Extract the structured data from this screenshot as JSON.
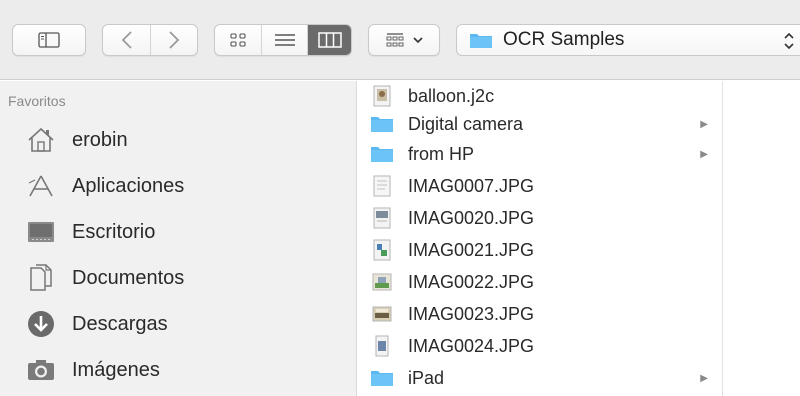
{
  "path": {
    "folder_name": "OCR Samples"
  },
  "sidebar": {
    "heading": "Favoritos",
    "items": [
      {
        "label": "erobin",
        "icon": "home-icon"
      },
      {
        "label": "Aplicaciones",
        "icon": "applications-icon"
      },
      {
        "label": "Escritorio",
        "icon": "desktop-icon"
      },
      {
        "label": "Documentos",
        "icon": "documents-icon"
      },
      {
        "label": "Descargas",
        "icon": "downloads-icon"
      },
      {
        "label": "Imágenes",
        "icon": "camera-icon"
      }
    ]
  },
  "files": [
    {
      "name": "balloon.j2c",
      "kind": "image"
    },
    {
      "name": "Digital camera",
      "kind": "folder"
    },
    {
      "name": "from HP",
      "kind": "folder"
    },
    {
      "name": "IMAG0007.JPG",
      "kind": "image"
    },
    {
      "name": "IMAG0020.JPG",
      "kind": "image"
    },
    {
      "name": "IMAG0021.JPG",
      "kind": "image"
    },
    {
      "name": "IMAG0022.JPG",
      "kind": "image"
    },
    {
      "name": "IMAG0023.JPG",
      "kind": "image"
    },
    {
      "name": "IMAG0024.JPG",
      "kind": "image"
    },
    {
      "name": "iPad",
      "kind": "folder"
    }
  ],
  "colors": {
    "folder": "#5cb8f0",
    "active_view": "#6b6b6b",
    "sidebar_bg": "#f1f1f1"
  }
}
